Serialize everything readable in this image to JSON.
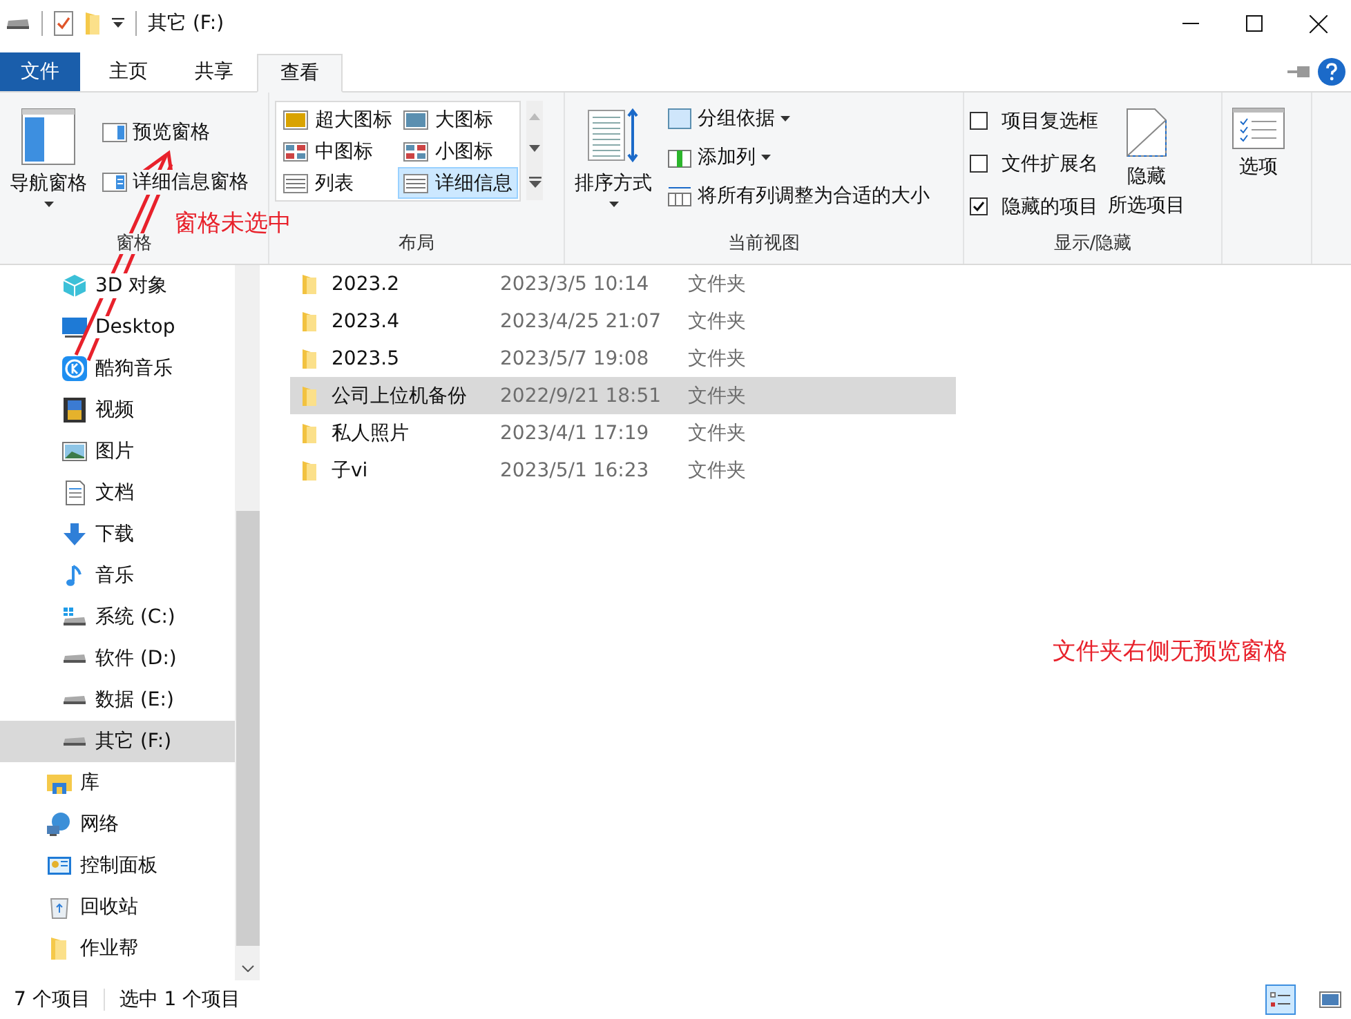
{
  "title_bar": {
    "title": "其它 (F:)"
  },
  "ribbon_tabs": [
    {
      "label": "文件",
      "kind": "file",
      "selected": false
    },
    {
      "label": "主页",
      "kind": "tab",
      "selected": false
    },
    {
      "label": "共享",
      "kind": "tab",
      "selected": false
    },
    {
      "label": "查看",
      "kind": "tab",
      "selected": true
    }
  ],
  "panes_group": {
    "nav_pane": "导航窗格",
    "preview_pane": {
      "label": "预览窗格",
      "selected": false
    },
    "details_pane": {
      "label": "详细信息窗格",
      "selected": false
    },
    "label": "窗格"
  },
  "layout_group": {
    "options": [
      {
        "label": "超大图标",
        "selected": false
      },
      {
        "label": "大图标",
        "selected": false
      },
      {
        "label": "中图标",
        "selected": false
      },
      {
        "label": "小图标",
        "selected": false
      },
      {
        "label": "列表",
        "selected": false
      },
      {
        "label": "详细信息",
        "selected": true
      }
    ],
    "label": "布局"
  },
  "current_view_group": {
    "sort": "排序方式",
    "group_by": "分组依据",
    "add_column": "添加列",
    "fit_columns": "将所有列调整为合适的大小",
    "label": "当前视图"
  },
  "show_hide_group": {
    "checkboxes": [
      {
        "label": "项目复选框",
        "checked": false
      },
      {
        "label": "文件扩展名",
        "checked": false
      },
      {
        "label": "隐藏的项目",
        "checked": true
      }
    ],
    "hide_selected": [
      "隐藏",
      "所选项目"
    ],
    "label": "显示/隐藏"
  },
  "options_button": "选项",
  "sidebar": {
    "items": [
      {
        "label": "3D 对象",
        "kind": "objects",
        "selected": false
      },
      {
        "label": "Desktop",
        "kind": "desktop",
        "selected": false
      },
      {
        "label": "酷狗音乐",
        "kind": "app",
        "selected": false
      },
      {
        "label": "视频",
        "kind": "video",
        "selected": false
      },
      {
        "label": "图片",
        "kind": "pictures",
        "selected": false
      },
      {
        "label": "文档",
        "kind": "documents",
        "selected": false
      },
      {
        "label": "下载",
        "kind": "downloads",
        "selected": false
      },
      {
        "label": "音乐",
        "kind": "music",
        "selected": false
      },
      {
        "label": "系统 (C:)",
        "kind": "system-drive",
        "selected": false
      },
      {
        "label": "软件 (D:)",
        "kind": "drive",
        "selected": false
      },
      {
        "label": "数据 (E:)",
        "kind": "drive",
        "selected": false
      },
      {
        "label": "其它 (F:)",
        "kind": "drive",
        "selected": true
      },
      {
        "label": "库",
        "kind": "library",
        "selected": false,
        "top": true
      },
      {
        "label": "网络",
        "kind": "network",
        "selected": false,
        "top": true
      },
      {
        "label": "控制面板",
        "kind": "control-panel",
        "selected": false,
        "top": true
      },
      {
        "label": "回收站",
        "kind": "recycle-bin",
        "selected": false,
        "top": true
      },
      {
        "label": "作业帮",
        "kind": "folder",
        "selected": false,
        "top": true
      }
    ]
  },
  "files": [
    {
      "name": "2023.2",
      "modified": "2023/3/5 10:14",
      "type": "文件夹",
      "selected": false
    },
    {
      "name": "2023.4",
      "modified": "2023/4/25 21:07",
      "type": "文件夹",
      "selected": false
    },
    {
      "name": "2023.5",
      "modified": "2023/5/7 19:08",
      "type": "文件夹",
      "selected": false
    },
    {
      "name": "公司上位机备份",
      "modified": "2022/9/21 18:51",
      "type": "文件夹",
      "selected": true
    },
    {
      "name": "私人照片",
      "modified": "2023/4/1 17:19",
      "type": "文件夹",
      "selected": false
    },
    {
      "name": "子vi",
      "modified": "2023/5/1 16:23",
      "type": "文件夹",
      "selected": false
    }
  ],
  "status_bar": {
    "item_count": "7 个项目",
    "selection": "选中 1 个项目"
  },
  "view_buttons": [
    {
      "kind": "details",
      "selected": true
    },
    {
      "kind": "large-icons",
      "selected": false
    }
  ],
  "annotations": [
    {
      "text": "窗格未选中",
      "kind": "pane-note"
    },
    {
      "text": "文件夹右侧无预览窗格",
      "kind": "side-note"
    }
  ]
}
